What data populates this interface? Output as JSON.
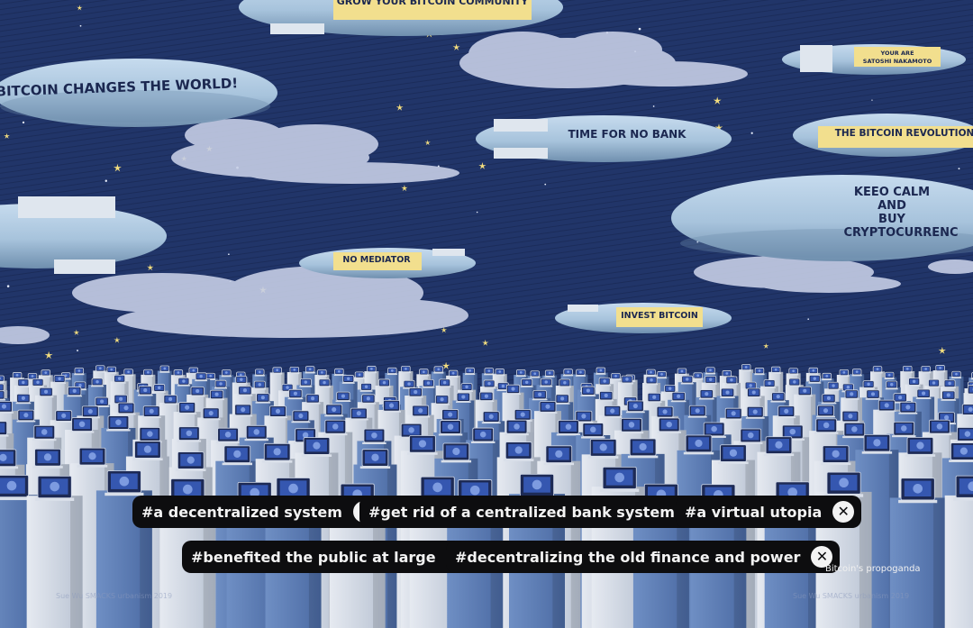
{
  "blimps": [
    {
      "id": "grow",
      "text": "GROW YOUR BITCOIN COMMUNITY"
    },
    {
      "id": "satoshi",
      "lines": [
        "YOUR ARE",
        "SATOSHI NAKAMOTO"
      ]
    },
    {
      "id": "changes",
      "text": "BITCOIN CHANGES THE WORLD!"
    },
    {
      "id": "nobank",
      "text": "TIME FOR NO BANK"
    },
    {
      "id": "revolution",
      "text": "THE BITCOIN REVOLUTION"
    },
    {
      "id": "keep",
      "lines": [
        "KEEO CALM",
        "AND",
        "BUY",
        "CRYPTOCURRENC"
      ]
    },
    {
      "id": "mediator",
      "text": "NO MEDIATOR"
    },
    {
      "id": "invest",
      "text": "INVEST BITCOIN"
    }
  ],
  "tags": [
    {
      "label": "#a decentralized system",
      "close": "✕"
    },
    {
      "label": "#get rid of a centralized bank system",
      "close": "✕"
    },
    {
      "label": "#a virtual utopia",
      "close": "✕"
    },
    {
      "label": "#benefited the public at large",
      "close": "✕"
    },
    {
      "label": "#decentralizing the old finance and power",
      "close": "✕"
    }
  ],
  "caption": "Bitcoin's propoganda",
  "credits": [
    "Sue Wu SMACKS urbanism 2019",
    "Sue Wu SMACKS urbanism 2019"
  ],
  "colors": {
    "sky": "#1f3266",
    "blimp": "#aac6de",
    "banner": "#f2df8e",
    "tag_bg": "#0d0d0f",
    "tag_text": "#f3f3f3"
  }
}
